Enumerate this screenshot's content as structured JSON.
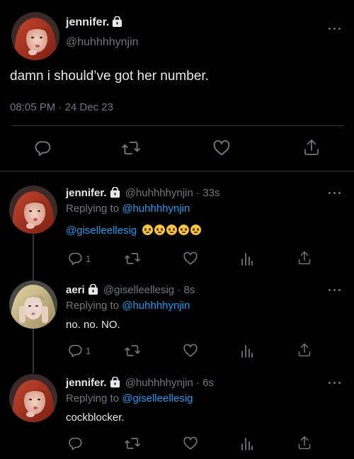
{
  "main_tweet": {
    "display_name": "jennifer.",
    "handle": "@huhhhhynjin",
    "text": "damn i should’ve got her number.",
    "time": "08:05 PM",
    "date": "24 Dec 23",
    "separator": "·"
  },
  "replies": [
    {
      "display_name": "jennifer.",
      "handle": "@huhhhhynjin",
      "time_ago": "33s",
      "replying_label": "Replying to",
      "replying_to": "@huhhhhynjin",
      "mention": "@giselleellesig",
      "reply_count": "1"
    },
    {
      "display_name": "aeri",
      "handle": "@giselleellesig",
      "time_ago": "8s",
      "replying_label": "Replying to",
      "replying_to": "@huhhhhynjin",
      "text": "no. no. NO.",
      "reply_count": "1"
    },
    {
      "display_name": "jennifer.",
      "handle": "@huhhhhynjin",
      "time_ago": "6s",
      "replying_label": "Replying to",
      "replying_to": "@giselleellesig",
      "text": "cockblocker."
    }
  ],
  "colors": {
    "background": "#000000",
    "text": "#e7e9ea",
    "muted": "#71767b",
    "accent": "#1d9bf0",
    "divider": "#2f3336"
  },
  "icons": {
    "reply": "reply-icon",
    "retweet": "retweet-icon",
    "like": "heart-icon",
    "views": "views-icon",
    "share": "share-icon",
    "more": "more-icon",
    "lock": "lock-icon"
  }
}
